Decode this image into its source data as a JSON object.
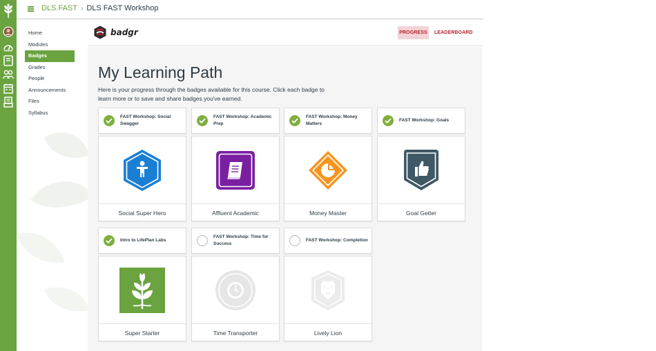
{
  "breadcrumb": {
    "course": "DLS.FAST",
    "page": "DLS FAST Workshop"
  },
  "course_nav": [
    {
      "label": "Home",
      "active": false
    },
    {
      "label": "Modules",
      "active": false
    },
    {
      "label": "Badges",
      "active": true
    },
    {
      "label": "Grades",
      "active": false
    },
    {
      "label": "People",
      "active": false
    },
    {
      "label": "Announcements",
      "active": false
    },
    {
      "label": "Files",
      "active": false
    },
    {
      "label": "Syllabus",
      "active": false
    }
  ],
  "badgr": {
    "brand": "badgr",
    "tabs": {
      "progress": "PROGRESS",
      "leaderboard": "LEADERBOARD"
    },
    "active_tab": "progress"
  },
  "page": {
    "title": "My Learning Path",
    "intro": "Here is your progress through the badges available for this course. Click each badge to learn more or to save and share badges you've earned."
  },
  "badges": [
    {
      "task": "FAST Workshop: Social Swagger",
      "name": "Social Super Hero",
      "done": true,
      "icon": "hexagon-person-icon"
    },
    {
      "task": "FAST Workshop: Academic Prep",
      "name": "Affluent Academic",
      "done": true,
      "icon": "book-icon"
    },
    {
      "task": "FAST Workshop: Money Matters",
      "name": "Money Master",
      "done": true,
      "icon": "pie-chart-diamond-icon"
    },
    {
      "task": "FAST Workshop: Goals",
      "name": "Goal Getter",
      "done": true,
      "icon": "thumbs-up-shield-icon"
    },
    {
      "task": "Intro to LifePlan Labs",
      "name": "Super Starter",
      "done": true,
      "icon": "sprout-icon"
    },
    {
      "task": "FAST Workshop: Time for Success",
      "name": "Time Transporter",
      "done": false,
      "icon": "clock-icon"
    },
    {
      "task": "FAST Workshop: Completion",
      "name": "Lively Lion",
      "done": false,
      "icon": "lion-icon"
    }
  ],
  "colors": {
    "green": "#6aa33f",
    "check": "#7fae3e",
    "badgr_red": "#b5242f",
    "progress_bg": "#f3d3d6",
    "hero_blue": "#1a7fd4",
    "academic_purple": "#7a1fa2",
    "money_orange": "#f7941d",
    "goal_slate": "#3f5866",
    "starter_green": "#6aa33f",
    "locked_gray": "#e6e6e6"
  }
}
